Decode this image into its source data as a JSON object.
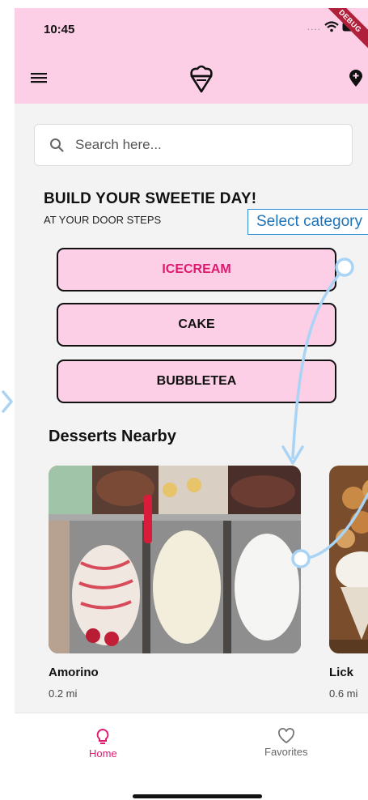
{
  "status_bar": {
    "time": "10:45",
    "debug_banner": "DEBUG"
  },
  "search": {
    "placeholder": "Search here..."
  },
  "hero": {
    "headline": "BUILD YOUR SWEETIE DAY!",
    "subheadline": "AT YOUR DOOR STEPS"
  },
  "categories": [
    {
      "label": "ICECREAM",
      "selected": true
    },
    {
      "label": "CAKE",
      "selected": false
    },
    {
      "label": "BUBBLETEA",
      "selected": false
    }
  ],
  "nearby": {
    "title": "Desserts Nearby",
    "items": [
      {
        "name": "Amorino",
        "distance": "0.2 mi"
      },
      {
        "name": "Lick",
        "distance": "0.6 mi"
      }
    ]
  },
  "bottom_nav": {
    "items": [
      {
        "label": "Home",
        "icon": "lightbulb-icon",
        "active": true
      },
      {
        "label": "Favorites",
        "icon": "heart-icon",
        "active": false
      }
    ]
  },
  "annotation": {
    "tooltip": "Select category"
  },
  "colors": {
    "header_pink": "#fccfe6",
    "accent": "#e0186f",
    "annotation_blue": "#2e8fd6"
  }
}
